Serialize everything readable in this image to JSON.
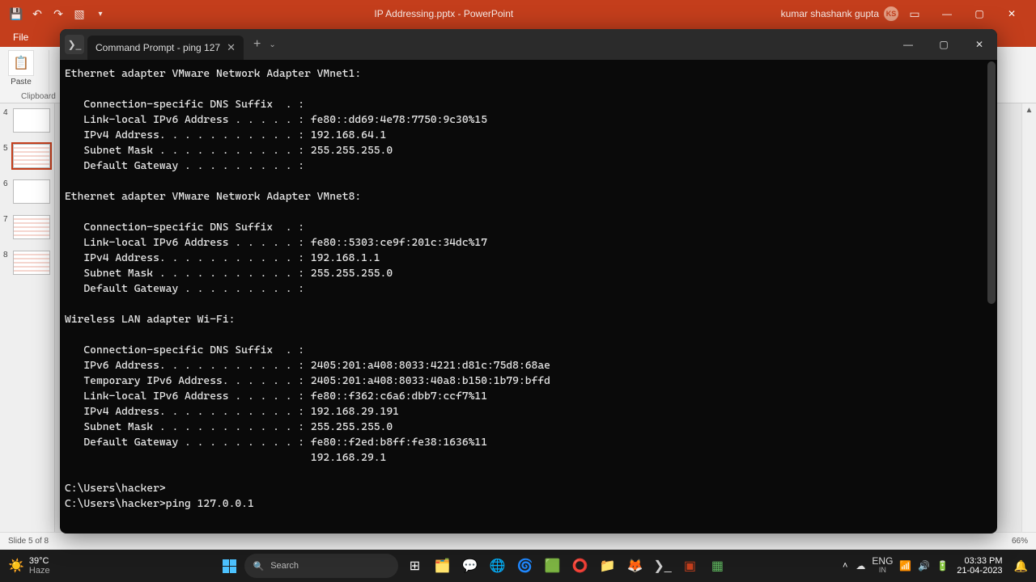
{
  "powerpoint": {
    "doc_title": "IP Addressing.pptx - PowerPoint",
    "user_name": "kumar shashank gupta",
    "user_initials": "KS",
    "file_tab": "File",
    "clipboard_label": "Clipboard",
    "paste_label": "Paste",
    "status_left": "Slide 5 of 8",
    "status_zoom": "66%",
    "thumbs": [
      "4",
      "5",
      "6",
      "7",
      "8"
    ]
  },
  "terminal": {
    "tab_title": "Command Prompt - ping  127",
    "lines": [
      "Ethernet adapter VMware Network Adapter VMnet1:",
      "",
      "   Connection-specific DNS Suffix  . :",
      "   Link-local IPv6 Address . . . . . : fe80::dd69:4e78:7750:9c30%15",
      "   IPv4 Address. . . . . . . . . . . : 192.168.64.1",
      "   Subnet Mask . . . . . . . . . . . : 255.255.255.0",
      "   Default Gateway . . . . . . . . . :",
      "",
      "Ethernet adapter VMware Network Adapter VMnet8:",
      "",
      "   Connection-specific DNS Suffix  . :",
      "   Link-local IPv6 Address . . . . . : fe80::5303:ce9f:201c:34dc%17",
      "   IPv4 Address. . . . . . . . . . . : 192.168.1.1",
      "   Subnet Mask . . . . . . . . . . . : 255.255.255.0",
      "   Default Gateway . . . . . . . . . :",
      "",
      "Wireless LAN adapter Wi-Fi:",
      "",
      "   Connection-specific DNS Suffix  . :",
      "   IPv6 Address. . . . . . . . . . . : 2405:201:a408:8033:4221:d81c:75d8:68ae",
      "   Temporary IPv6 Address. . . . . . : 2405:201:a408:8033:40a8:b150:1b79:bffd",
      "   Link-local IPv6 Address . . . . . : fe80::f362:c6a6:dbb7:ccf7%11",
      "   IPv4 Address. . . . . . . . . . . : 192.168.29.191",
      "   Subnet Mask . . . . . . . . . . . : 255.255.255.0",
      "   Default Gateway . . . . . . . . . : fe80::f2ed:b8ff:fe38:1636%11",
      "                                       192.168.29.1",
      "",
      "C:\\Users\\hacker>",
      "C:\\Users\\hacker>ping 127.0.0.1"
    ]
  },
  "taskbar": {
    "weather_temp": "39°C",
    "weather_desc": "Haze",
    "search_placeholder": "Search",
    "lang": "ENG",
    "locale": "IN",
    "time": "03:33 PM",
    "date": "21-04-2023"
  }
}
